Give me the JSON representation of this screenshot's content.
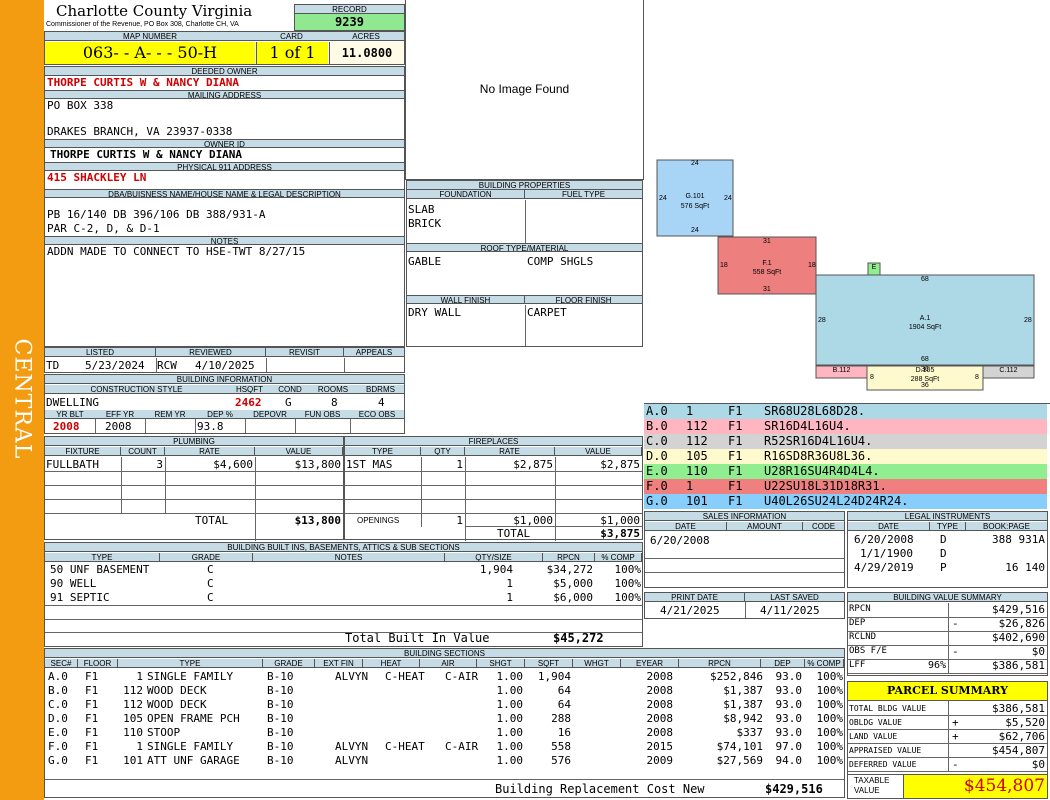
{
  "header": {
    "county": "Charlotte County Virginia",
    "commissioner": "Commissioner of the Revenue, PO Box 308, Charlotte CH, VA",
    "record_label": "RECORD",
    "record": "9239",
    "map_label": "MAP NUMBER",
    "map_number": "063- - A- - - 50-H",
    "card_label": "CARD",
    "card": "1 of 1",
    "acres_label": "ACRES",
    "acres": "11.0800"
  },
  "sidebar": {
    "label": "CENTRAL"
  },
  "owner": {
    "deeded_label": "DEEDED OWNER",
    "deeded": "THORPE CURTIS W & NANCY DIANA",
    "mailing_label": "MAILING ADDRESS",
    "mailing_line1": "PO BOX 338",
    "mailing_line2": "DRAKES BRANCH, VA 23937-0338",
    "owner_id_label": "OWNER ID",
    "owner_id": "THORPE CURTIS W & NANCY DIANA",
    "physical_label": "PHYSICAL 911 ADDRESS",
    "physical": "415 SHACKLEY LN",
    "dba_label": "DBA/BUISNESS NAME/HOUSE NAME & LEGAL DESCRIPTION",
    "legal1": "PB 16/140 DB 396/106 DB 388/931-A",
    "legal2": "PAR C-2, D, & D-1",
    "notes_label": "NOTES",
    "notes": "ADDN MADE TO CONNECT TO HSE-TWT 8/27/15"
  },
  "image": {
    "text": "No Image Found"
  },
  "listing": {
    "listed_label": "LISTED",
    "reviewed_label": "REVIEWED",
    "revisit_label": "REVISIT",
    "appeals_label": "APPEALS",
    "listed_by": "TD",
    "listed_date": "5/23/2024",
    "reviewed_by": "RCW",
    "reviewed_date": "4/10/2025"
  },
  "building_info": {
    "label": "BUILDING INFORMATION",
    "style_label": "CONSTRUCTION STYLE",
    "hsqft_label": "HSQFT",
    "cond_label": "COND",
    "rooms_label": "ROOMS",
    "bdrms_label": "BDRMS",
    "style": "DWELLING",
    "hsqft": "2462",
    "cond": "G",
    "rooms": "8",
    "bdrms": "4",
    "yrblt_label": "YR BLT",
    "effyr_label": "EFF YR",
    "remyr_label": "REM YR",
    "dep_label": "DEP %",
    "depovr_label": "DEPOVR",
    "funobs_label": "FUN OBS",
    "ecoobs_label": "ECO OBS",
    "yrblt": "2008",
    "effyr": "2008",
    "dep": "93.8"
  },
  "building_props": {
    "label": "BUILDING PROPERTIES",
    "foundation_label": "FOUNDATION",
    "fuel_label": "FUEL TYPE",
    "foundation1": "SLAB",
    "foundation2": "BRICK",
    "roof_label": "ROOF TYPE/MATERIAL",
    "roof_type": "GABLE",
    "roof_material": "COMP SHGLS",
    "wall_label": "WALL FINISH",
    "floor_label": "FLOOR FINISH",
    "wall": "DRY WALL",
    "floor": "CARPET"
  },
  "plumbing": {
    "label": "PLUMBING",
    "headers": [
      "FIXTURE",
      "COUNT",
      "RATE",
      "VALUE"
    ],
    "rows": [
      [
        "FULLBATH",
        "3",
        "$4,600",
        "$13,800"
      ]
    ],
    "total_label": "TOTAL",
    "total": "$13,800"
  },
  "fireplaces": {
    "label": "FIREPLACES",
    "headers": [
      "TYPE",
      "QTY",
      "RATE",
      "VALUE"
    ],
    "rows": [
      [
        "1ST MAS",
        "1",
        "$2,875",
        "$2,875"
      ]
    ],
    "openings_label": "OPENINGS",
    "openings_qty": "1",
    "openings_rate": "$1,000",
    "openings_value": "$1,000",
    "total_label": "TOTAL",
    "total": "$3,875"
  },
  "builtins": {
    "label": "BUILDING BUILT INS, BASEMENTS, ATTICS & SUB SECTIONS",
    "headers": [
      "TYPE",
      "GRADE",
      "NOTES",
      "QTY/SIZE",
      "RPCN",
      "% COMP"
    ],
    "rows": [
      [
        "50 UNF BASEMENT",
        "C",
        "",
        "1,904",
        "$34,272",
        "100%"
      ],
      [
        "90 WELL",
        "C",
        "",
        "1",
        "$5,000",
        "100%"
      ],
      [
        "91 SEPTIC",
        "C",
        "",
        "1",
        "$6,000",
        "100%"
      ]
    ],
    "total_label": "Total Built In Value",
    "total": "$45,272"
  },
  "sections": {
    "label": "BUILDING SECTIONS",
    "headers": [
      "SEC#",
      "FLOOR",
      "TYPE",
      "GRADE",
      "EXT FIN",
      "HEAT",
      "AIR",
      "SHGT",
      "SQFT",
      "WHGT",
      "EYEAR",
      "RPCN",
      "DEP",
      "% COMP"
    ],
    "rows": [
      [
        "A.0",
        "F1",
        "1 SINGLE FAMILY",
        "B-10",
        "ALVYN",
        "C-HEAT",
        "C-AIR",
        "1.00",
        "1,904",
        "",
        "2008",
        "$252,846",
        "93.0",
        "100%"
      ],
      [
        "B.0",
        "F1",
        "112 WOOD DECK",
        "B-10",
        "",
        "",
        "",
        "1.00",
        "64",
        "",
        "2008",
        "$1,387",
        "93.0",
        "100%"
      ],
      [
        "C.0",
        "F1",
        "112 WOOD DECK",
        "B-10",
        "",
        "",
        "",
        "1.00",
        "64",
        "",
        "2008",
        "$1,387",
        "93.0",
        "100%"
      ],
      [
        "D.0",
        "F1",
        "105 OPEN FRAME PCH",
        "B-10",
        "",
        "",
        "",
        "1.00",
        "288",
        "",
        "2008",
        "$8,942",
        "93.0",
        "100%"
      ],
      [
        "E.0",
        "F1",
        "110 STOOP",
        "B-10",
        "",
        "",
        "",
        "1.00",
        "16",
        "",
        "2008",
        "$337",
        "93.0",
        "100%"
      ],
      [
        "F.0",
        "F1",
        "1 SINGLE FAMILY",
        "B-10",
        "ALVYN",
        "C-HEAT",
        "C-AIR",
        "1.00",
        "558",
        "",
        "2015",
        "$74,101",
        "97.0",
        "100%"
      ],
      [
        "G.0",
        "F1",
        "101 ATT UNF GARAGE",
        "B-10",
        "ALVYN",
        "",
        "",
        "1.00",
        "576",
        "",
        "2009",
        "$27,569",
        "94.0",
        "100%"
      ]
    ],
    "total_label": "Building Replacement Cost New",
    "total": "$429,516"
  },
  "sketch": {
    "labels": [
      {
        "id": "G.101",
        "sqft": "576 SqFt"
      },
      {
        "id": "F.1",
        "sqft": "558 SqFt"
      },
      {
        "id": "A.1",
        "sqft": "1904 SqFt"
      },
      {
        "id": "B.112",
        "sqft": ""
      },
      {
        "id": "D.105",
        "sqft": "288 SqFt"
      },
      {
        "id": "C.112",
        "sqft": ""
      },
      {
        "id": "E",
        "sqft": ""
      }
    ],
    "dims": [
      "24",
      "24",
      "24",
      "24",
      "31",
      "31",
      "18",
      "18",
      "68",
      "68",
      "28",
      "28",
      "36",
      "36",
      "8",
      "8"
    ],
    "colors": {
      "G": "#a8d4f5",
      "F": "#ee7f7f",
      "A": "#add8e6",
      "B": "#ffb6c1",
      "C": "#d3d3d3",
      "D": "#fffacd",
      "E": "#90ee90"
    }
  },
  "codes": [
    {
      "sec": "A.0",
      "num": "1",
      "fl": "F1",
      "code": "SR68U28L68D28.",
      "color": "#add8e6"
    },
    {
      "sec": "B.0",
      "num": "112",
      "fl": "F1",
      "code": "SR16D4L16U4.",
      "color": "#ffb6c1"
    },
    {
      "sec": "C.0",
      "num": "112",
      "fl": "F1",
      "code": "R52SR16D4L16U4.",
      "color": "#d3d3d3"
    },
    {
      "sec": "D.0",
      "num": "105",
      "fl": "F1",
      "code": "R16SD8R36U8L36.",
      "color": "#fffacd"
    },
    {
      "sec": "E.0",
      "num": "110",
      "fl": "F1",
      "code": "U28R16SU4R4D4L4.",
      "color": "#90ee90"
    },
    {
      "sec": "F.0",
      "num": "1",
      "fl": "F1",
      "code": "U22SU18L31D18R31.",
      "color": "#f08080"
    },
    {
      "sec": "G.0",
      "num": "101",
      "fl": "F1",
      "code": "U40L26SU24L24D24R24.",
      "color": "#87cefa"
    }
  ],
  "sales": {
    "label": "SALES INFORMATION",
    "headers": [
      "DATE",
      "AMOUNT",
      "CODE"
    ],
    "rows": [
      [
        "6/20/2008",
        "",
        ""
      ]
    ]
  },
  "legal": {
    "label": "LEGAL INSTRUMENTS",
    "headers": [
      "DATE",
      "TYPE",
      "BOOK:PAGE"
    ],
    "rows": [
      [
        "6/20/2008",
        "D",
        "388 931A"
      ],
      [
        "1/1/1900",
        "D",
        ""
      ],
      [
        "4/29/2019",
        "P",
        "16 140"
      ]
    ]
  },
  "dates": {
    "print_label": "PRINT DATE",
    "saved_label": "LAST SAVED",
    "print": "4/21/2025",
    "saved": "4/11/2025"
  },
  "value_summary": {
    "label": "BUILDING VALUE SUMMARY",
    "rows": [
      {
        "name": "RPCN",
        "op": "",
        "pct": "",
        "value": "$429,516"
      },
      {
        "name": "DEP",
        "op": "-",
        "pct": "",
        "value": "$26,826"
      },
      {
        "name": "RCLND",
        "op": "",
        "pct": "",
        "value": "$402,690"
      },
      {
        "name": "OBS F/E",
        "op": "-",
        "pct": "",
        "value": "$0"
      },
      {
        "name": "LFF",
        "op": "",
        "pct": "96%",
        "value": "$386,581"
      }
    ]
  },
  "parcel": {
    "label": "PARCEL SUMMARY",
    "rows": [
      {
        "name": "TOTAL BLDG VALUE",
        "op": "",
        "value": "$386,581"
      },
      {
        "name": "OBLDG VALUE",
        "op": "+",
        "value": "$5,520"
      },
      {
        "name": "LAND VALUE",
        "op": "+",
        "value": "$62,706"
      },
      {
        "name": "APPRAISED VALUE",
        "op": "",
        "value": "$454,807"
      },
      {
        "name": "DEFERRED VALUE",
        "op": "-",
        "value": "$0"
      }
    ],
    "taxable_label1": "TAXABLE",
    "taxable_label2": "VALUE",
    "taxable": "$454,807"
  }
}
